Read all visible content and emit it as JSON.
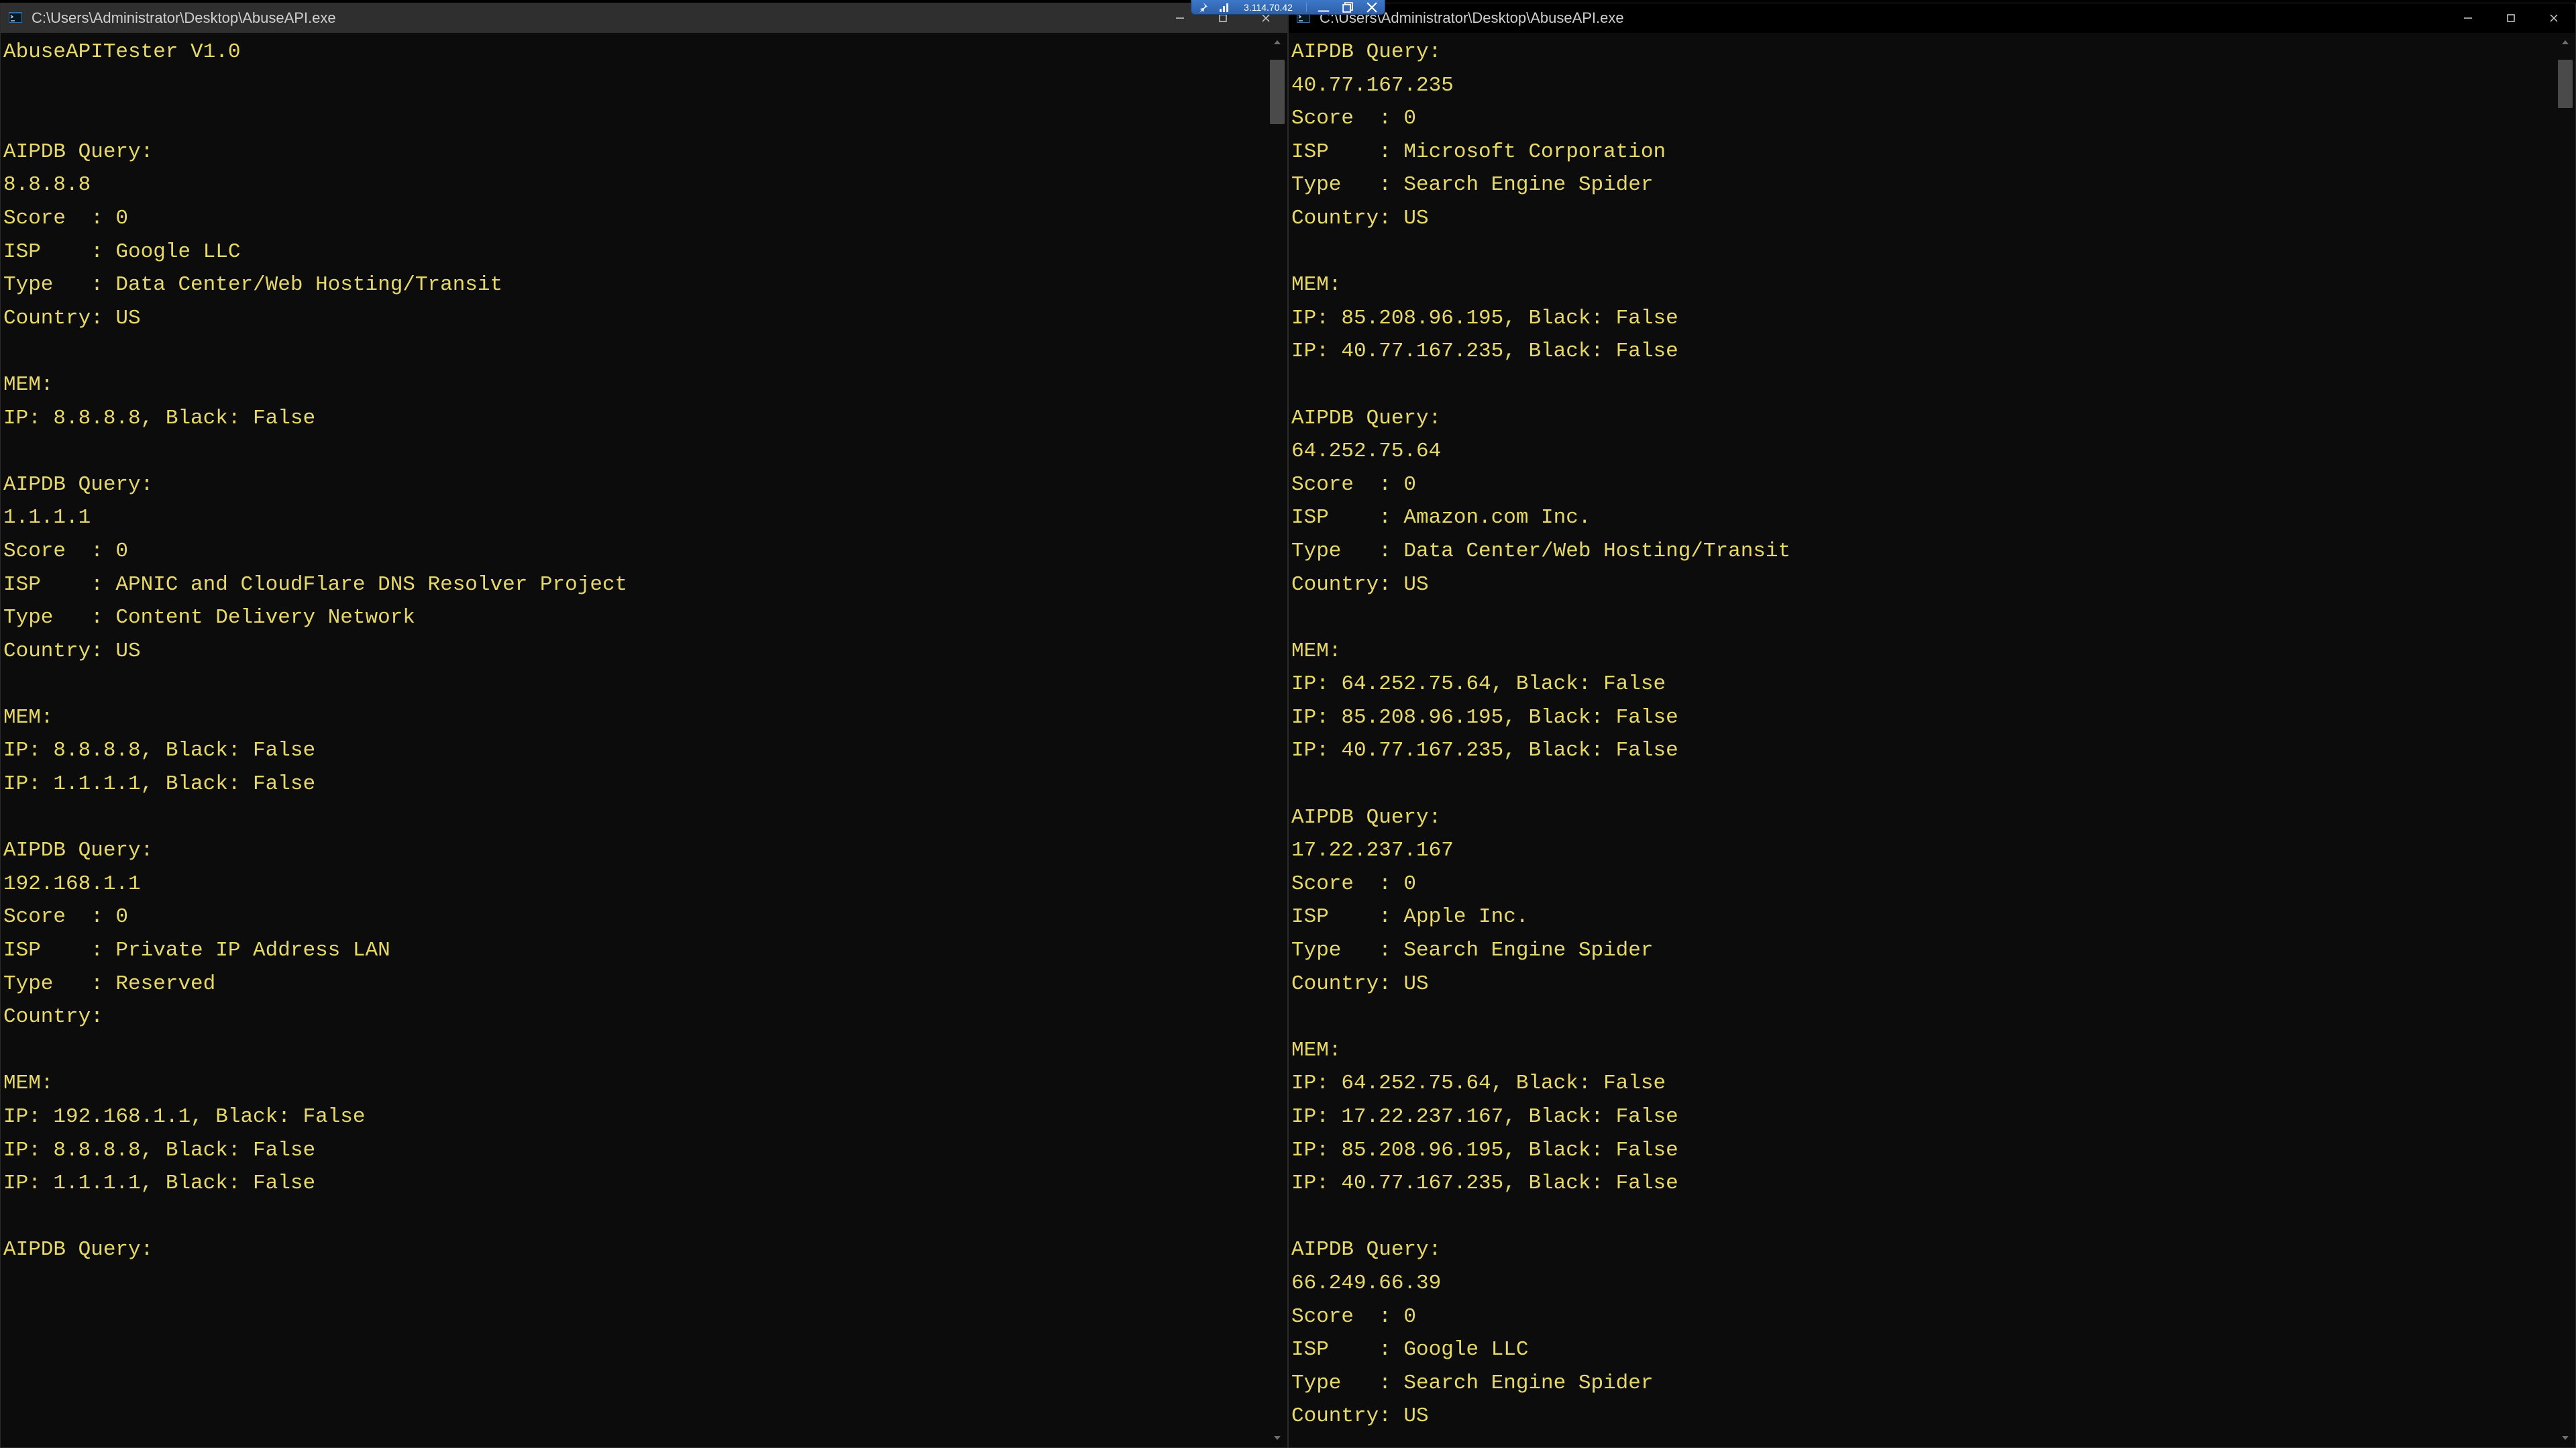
{
  "connection_bar": {
    "ip": "3.114.70.42",
    "icons": [
      "pin-icon",
      "signal-icon"
    ],
    "buttons": [
      "minimize",
      "restore",
      "close"
    ]
  },
  "windows": [
    {
      "id": "left",
      "title": "C:\\Users\\Administrator\\Desktop\\AbuseAPI.exe",
      "active": false,
      "scroll_thumb": {
        "top_pct": 2,
        "height_pct": 8
      },
      "lines": [
        "AbuseAPITester V1.0",
        "",
        "",
        "AIPDB Query:",
        "8.8.8.8",
        "Score  : 0",
        "ISP    : Google LLC",
        "Type   : Data Center/Web Hosting/Transit",
        "Country: US",
        "",
        "MEM:",
        "IP: 8.8.8.8, Black: False",
        "",
        "AIPDB Query:",
        "1.1.1.1",
        "Score  : 0",
        "ISP    : APNIC and CloudFlare DNS Resolver Project",
        "Type   : Content Delivery Network",
        "Country: US",
        "",
        "MEM:",
        "IP: 8.8.8.8, Black: False",
        "IP: 1.1.1.1, Black: False",
        "",
        "AIPDB Query:",
        "192.168.1.1",
        "Score  : 0",
        "ISP    : Private IP Address LAN",
        "Type   : Reserved",
        "Country:",
        "",
        "MEM:",
        "IP: 192.168.1.1, Black: False",
        "IP: 8.8.8.8, Black: False",
        "IP: 1.1.1.1, Black: False",
        "",
        "AIPDB Query:"
      ]
    },
    {
      "id": "right",
      "title": "C:\\Users\\Administrator\\Desktop\\AbuseAPI.exe",
      "active": true,
      "scroll_thumb": {
        "top_pct": 2,
        "height_pct": 6
      },
      "lines": [
        "AIPDB Query:",
        "40.77.167.235",
        "Score  : 0",
        "ISP    : Microsoft Corporation",
        "Type   : Search Engine Spider",
        "Country: US",
        "",
        "MEM:",
        "IP: 85.208.96.195, Black: False",
        "IP: 40.77.167.235, Black: False",
        "",
        "AIPDB Query:",
        "64.252.75.64",
        "Score  : 0",
        "ISP    : Amazon.com Inc.",
        "Type   : Data Center/Web Hosting/Transit",
        "Country: US",
        "",
        "MEM:",
        "IP: 64.252.75.64, Black: False",
        "IP: 85.208.96.195, Black: False",
        "IP: 40.77.167.235, Black: False",
        "",
        "AIPDB Query:",
        "17.22.237.167",
        "Score  : 0",
        "ISP    : Apple Inc.",
        "Type   : Search Engine Spider",
        "Country: US",
        "",
        "MEM:",
        "IP: 64.252.75.64, Black: False",
        "IP: 17.22.237.167, Black: False",
        "IP: 85.208.96.195, Black: False",
        "IP: 40.77.167.235, Black: False",
        "",
        "AIPDB Query:",
        "66.249.66.39",
        "Score  : 0",
        "ISP    : Google LLC",
        "Type   : Search Engine Spider",
        "Country: US"
      ]
    }
  ]
}
